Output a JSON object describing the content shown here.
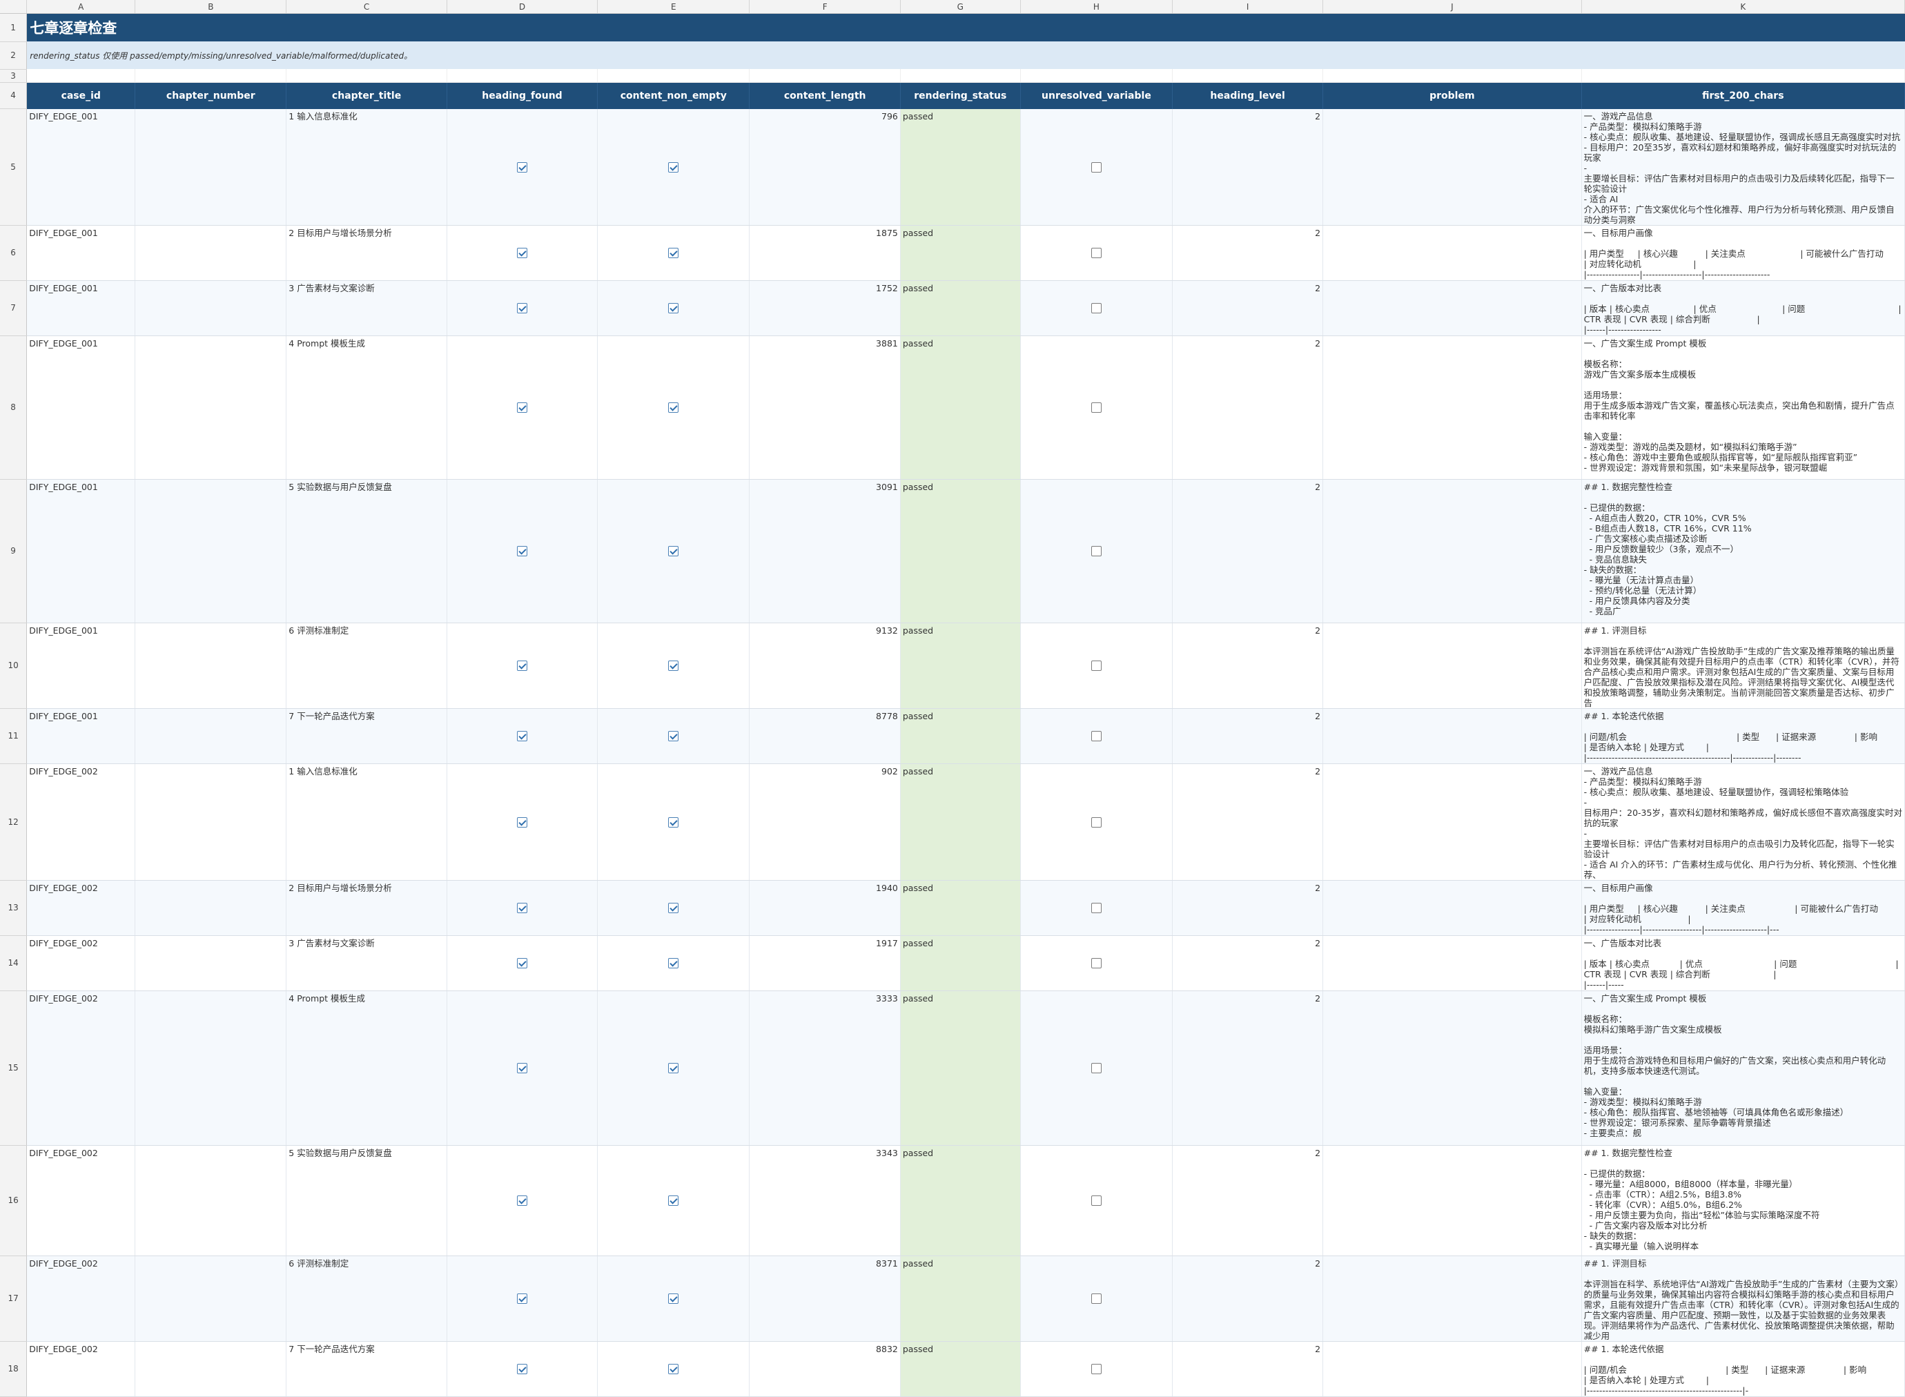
{
  "sheet": {
    "title": "七章逐章检查",
    "note": "rendering_status 仅使用 passed/empty/missing/unresolved_variable/malformed/duplicated。",
    "column_letters": [
      "A",
      "B",
      "C",
      "D",
      "E",
      "F",
      "G",
      "H",
      "I",
      "J",
      "K"
    ],
    "headers": [
      "case_id",
      "chapter_number",
      "chapter_title",
      "heading_found",
      "content_non_empty",
      "content_length",
      "rendering_status",
      "unresolved_variable",
      "heading_level",
      "problem",
      "first_200_chars"
    ],
    "colors": {
      "title_bg": "#1f4e79",
      "note_bg": "#dce9f5",
      "status_bg": "#e2f0d9"
    },
    "rows": [
      {
        "row": "5",
        "case_id": "DIFY_EDGE_001",
        "chapter_title": "1 输入信息标准化",
        "heading_found": true,
        "content_non_empty": true,
        "content_length": "796",
        "rendering_status": "passed",
        "unresolved_variable": false,
        "heading_level": "2",
        "problem": "",
        "first_200_chars": "一、游戏产品信息\n- 产品类型：模拟科幻策略手游\n- 核心卖点：舰队收集、基地建设、轻量联盟协作，强调成长感且无高强度实时对抗\n- 目标用户：20至35岁，喜欢科幻题材和策略养成，偏好非高强度实时对抗玩法的玩家\n-\n主要增长目标：评估广告素材对目标用户的点击吸引力及后续转化匹配，指导下一轮实验设计\n- 适合 AI\n介入的环节：广告文案优化与个性化推荐、用户行为分析与转化预测、用户反馈自动分类与洞察"
      },
      {
        "row": "6",
        "case_id": "DIFY_EDGE_001",
        "chapter_title": "2 目标用户与增长场景分析",
        "heading_found": true,
        "content_non_empty": true,
        "content_length": "1875",
        "rendering_status": "passed",
        "unresolved_variable": false,
        "heading_level": "2",
        "problem": "",
        "first_200_chars": "一、目标用户画像\n\n| 用户类型     | 核心兴趣          | 关注卖点                    | 可能被什么广告打动             | 对应转化动机                   |\n|-----------------|-------------------|---------------------"
      },
      {
        "row": "7",
        "case_id": "DIFY_EDGE_001",
        "chapter_title": "3 广告素材与文案诊断",
        "heading_found": true,
        "content_non_empty": true,
        "content_length": "1752",
        "rendering_status": "passed",
        "unresolved_variable": false,
        "heading_level": "2",
        "problem": "",
        "first_200_chars": "一、广告版本对比表\n\n| 版本 | 核心卖点                | 优点                        | 问题                                  | CTR 表现 | CVR 表现 | 综合判断                 |\n|------|-----------------"
      },
      {
        "row": "8",
        "case_id": "DIFY_EDGE_001",
        "chapter_title": "4 Prompt 模板生成",
        "heading_found": true,
        "content_non_empty": true,
        "content_length": "3881",
        "rendering_status": "passed",
        "unresolved_variable": false,
        "heading_level": "2",
        "problem": "",
        "first_200_chars": "一、广告文案生成 Prompt 模板\n\n模板名称：\n游戏广告文案多版本生成模板\n\n适用场景：\n用于生成多版本游戏广告文案，覆盖核心玩法卖点，突出角色和剧情，提升广告点击率和转化率\n\n输入变量：\n- 游戏类型：游戏的品类及题材，如“模拟科幻策略手游”\n- 核心角色：游戏中主要角色或舰队指挥官等，如“星际舰队指挥官莉亚”\n- 世界观设定：游戏背景和氛围，如“未来星际战争，银河联盟崛"
      },
      {
        "row": "9",
        "case_id": "DIFY_EDGE_001",
        "chapter_title": "5 实验数据与用户反馈复盘",
        "heading_found": true,
        "content_non_empty": true,
        "content_length": "3091",
        "rendering_status": "passed",
        "unresolved_variable": false,
        "heading_level": "2",
        "problem": "",
        "first_200_chars": "## 1. 数据完整性检查\n\n- 已提供的数据：\n  - A组点击人数20，CTR 10%，CVR 5%\n  - B组点击人数18，CTR 16%，CVR 11%\n  - 广告文案核心卖点描述及诊断\n  - 用户反馈数量较少（3条，观点不一）\n  - 竞品信息缺失\n- 缺失的数据：\n  - 曝光量（无法计算点击量）\n  - 预约/转化总量（无法计算）\n  - 用户反馈具体内容及分类\n  - 竞品广"
      },
      {
        "row": "10",
        "case_id": "DIFY_EDGE_001",
        "chapter_title": "6 评测标准制定",
        "heading_found": true,
        "content_non_empty": true,
        "content_length": "9132",
        "rendering_status": "passed",
        "unresolved_variable": false,
        "heading_level": "2",
        "problem": "",
        "first_200_chars": "## 1. 评测目标\n\n本评测旨在系统评估“AI游戏广告投放助手”生成的广告文案及推荐策略的输出质量和业务效果，确保其能有效提升目标用户的点击率（CTR）和转化率（CVR），并符合产品核心卖点和用户需求。评测对象包括AI生成的广告文案质量、文案与目标用户匹配度、广告投放效果指标及潜在风险。评测结果将指导文案优化、AI模型迭代和投放策略调整，辅助业务决策制定。当前评测能回答文案质量是否达标、初步广告"
      },
      {
        "row": "11",
        "case_id": "DIFY_EDGE_001",
        "chapter_title": "7 下一轮产品迭代方案",
        "heading_found": true,
        "content_non_empty": true,
        "content_length": "8778",
        "rendering_status": "passed",
        "unresolved_variable": false,
        "heading_level": "2",
        "problem": "",
        "first_200_chars": "## 1. 本轮迭代依据\n\n| 问题/机会                                        | 类型      | 证据来源              | 影响                     | 是否纳入本轮 | 处理方式        |\n|----------------------------------------------|-------------|--------"
      },
      {
        "row": "12",
        "case_id": "DIFY_EDGE_002",
        "chapter_title": "1 输入信息标准化",
        "heading_found": true,
        "content_non_empty": true,
        "content_length": "902",
        "rendering_status": "passed",
        "unresolved_variable": false,
        "heading_level": "2",
        "problem": "",
        "first_200_chars": "一、游戏产品信息\n- 产品类型：模拟科幻策略手游\n- 核心卖点：舰队收集、基地建设、轻量联盟协作，强调轻松策略体验\n-\n目标用户：20-35岁，喜欢科幻题材和策略养成，偏好成长感但不喜欢高强度实时对抗的玩家\n-\n主要增长目标：评估广告素材对目标用户的点击吸引力及转化匹配，指导下一轮实验设计\n- 适合 AI 介入的环节：广告素材生成与优化、用户行为分析、转化预测、个性化推荐、"
      },
      {
        "row": "13",
        "case_id": "DIFY_EDGE_002",
        "chapter_title": "2 目标用户与增长场景分析",
        "heading_found": true,
        "content_non_empty": true,
        "content_length": "1940",
        "rendering_status": "passed",
        "unresolved_variable": false,
        "heading_level": "2",
        "problem": "",
        "first_200_chars": "一、目标用户画像\n\n| 用户类型     | 核心兴趣          | 关注卖点                  | 可能被什么广告打动             | 对应转化动机                 |\n|-----------------|-------------------|--------------------|---"
      },
      {
        "row": "14",
        "case_id": "DIFY_EDGE_002",
        "chapter_title": "3 广告素材与文案诊断",
        "heading_found": true,
        "content_non_empty": true,
        "content_length": "1917",
        "rendering_status": "passed",
        "unresolved_variable": false,
        "heading_level": "2",
        "problem": "",
        "first_200_chars": "一、广告版本对比表\n\n| 版本 | 核心卖点           | 优点                          | 问题                                    | CTR 表现 | CVR 表现 | 综合判断                       |\n|------|-----"
      },
      {
        "row": "15",
        "case_id": "DIFY_EDGE_002",
        "chapter_title": "4 Prompt 模板生成",
        "heading_found": true,
        "content_non_empty": true,
        "content_length": "3333",
        "rendering_status": "passed",
        "unresolved_variable": false,
        "heading_level": "2",
        "problem": "",
        "first_200_chars": "一、广告文案生成 Prompt 模板\n\n模板名称：\n模拟科幻策略手游广告文案生成模板\n\n适用场景：\n用于生成符合游戏特色和目标用户偏好的广告文案，突出核心卖点和用户转化动机，支持多版本快速迭代测试。\n\n输入变量：\n- 游戏类型：模拟科幻策略手游\n- 核心角色：舰队指挥官、基地领袖等（可填具体角色名或形象描述）\n- 世界观设定：银河系探索、星际争霸等背景描述\n- 主要卖点：舰"
      },
      {
        "row": "16",
        "case_id": "DIFY_EDGE_002",
        "chapter_title": "5 实验数据与用户反馈复盘",
        "heading_found": true,
        "content_non_empty": true,
        "content_length": "3343",
        "rendering_status": "passed",
        "unresolved_variable": false,
        "heading_level": "2",
        "problem": "",
        "first_200_chars": "## 1. 数据完整性检查\n\n- 已提供的数据：\n  - 曝光量：A组8000，B组8000（样本量，非曝光量）\n  - 点击率（CTR）：A组2.5%，B组3.8%\n  - 转化率（CVR）：A组5.0%，B组6.2%\n  - 用户反馈主要为负向，指出“轻松”体验与实际策略深度不符\n  - 广告文案内容及版本对比分析\n- 缺失的数据：\n  - 真实曝光量（输入说明样本"
      },
      {
        "row": "17",
        "case_id": "DIFY_EDGE_002",
        "chapter_title": "6 评测标准制定",
        "heading_found": true,
        "content_non_empty": true,
        "content_length": "8371",
        "rendering_status": "passed",
        "unresolved_variable": false,
        "heading_level": "2",
        "problem": "",
        "first_200_chars": "## 1. 评测目标\n\n本评测旨在科学、系统地评估“AI游戏广告投放助手”生成的广告素材（主要为文案）的质量与业务效果，确保其输出内容符合模拟科幻策略手游的核心卖点和目标用户需求，且能有效提升广告点击率（CTR）和转化率（CVR）。评测对象包括AI生成的广告文案内容质量、用户匹配度、预期一致性，以及基于实验数据的业务效果表现。评测结果将作为产品迭代、广告素材优化、投放策略调整提供决策依据，帮助减少用"
      },
      {
        "row": "18",
        "case_id": "DIFY_EDGE_002",
        "chapter_title": "7 下一轮产品迭代方案",
        "heading_found": true,
        "content_non_empty": true,
        "content_length": "8832",
        "rendering_status": "passed",
        "unresolved_variable": false,
        "heading_level": "2",
        "problem": "",
        "first_200_chars": "## 1. 本轮迭代依据\n\n| 问题/机会                                    | 类型      | 证据来源              | 影响                     | 是否纳入本轮 | 处理方式        |\n|--------------------------------------------------|-"
      }
    ]
  }
}
